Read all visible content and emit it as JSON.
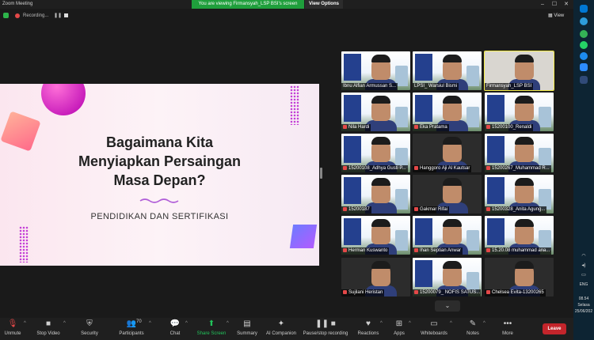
{
  "window": {
    "title": "Zoom Meeting",
    "viewing_banner": "You are viewing Firmansyah_LSP BSI's screen",
    "view_options": "View Options"
  },
  "status": {
    "recording_label": "Recording...",
    "view_label": "View"
  },
  "slide": {
    "title_line1": "Bagaimana Kita",
    "title_line2": "Menyiapkan Persaingan",
    "title_line3": "Masa Depan?",
    "subtitle": "PENDIDIKAN DAN SERTIFIKASI"
  },
  "participants": [
    {
      "name": "Ibnu Alfian Armussan S...",
      "muted": false,
      "style": "slide"
    },
    {
      "name": "LPSI_ Warsiul Bismi",
      "muted": false,
      "style": "slide"
    },
    {
      "name": "Firmansyah_LSP BSI",
      "muted": false,
      "style": "bright",
      "active": true
    },
    {
      "name": "Nila Hardi",
      "muted": true,
      "style": "slide"
    },
    {
      "name": "Eka Pratama",
      "muted": true,
      "style": "slide"
    },
    {
      "name": "15200100_Renaldi",
      "muted": true,
      "style": "slide"
    },
    {
      "name": "15200108_Adhya Gusti P...",
      "muted": true,
      "style": "slide"
    },
    {
      "name": "Hanggoro Aji Al Kautsar",
      "muted": true,
      "style": "dark"
    },
    {
      "name": "15200267_Muhammad R...",
      "muted": true,
      "style": "slide"
    },
    {
      "name": "15200187",
      "muted": true,
      "style": "slide"
    },
    {
      "name": "Gakmar Rifai",
      "muted": true,
      "style": "dark"
    },
    {
      "name": "15200328_Anita Agung...",
      "muted": true,
      "style": "slide"
    },
    {
      "name": "Herman Kuswanto",
      "muted": true,
      "style": "slide"
    },
    {
      "name": "Ihan Septian Anwar",
      "muted": true,
      "style": "slide"
    },
    {
      "name": "15.20.08 muhammad ana...",
      "muted": true,
      "style": "slide"
    },
    {
      "name": "Sujilani Heristan",
      "muted": true,
      "style": "dark"
    },
    {
      "name": "15200079_ NOFIS SATUS...",
      "muted": true,
      "style": "slide"
    },
    {
      "name": "Chelsea Evita-13200265",
      "muted": true,
      "style": "dark"
    }
  ],
  "toolbar": {
    "unmute": "Unmute",
    "stop_video": "Stop Video",
    "security": "Security",
    "participants": "Participants",
    "participants_count": "70",
    "chat": "Chat",
    "share_screen": "Share Screen",
    "summary": "Summary",
    "ai_companion": "AI Companion",
    "recording": "Pause/stop recording",
    "reactions": "Reactions",
    "apps": "Apps",
    "whiteboards": "Whiteboards",
    "notes": "Notes",
    "more": "More",
    "leave": "Leave"
  },
  "taskbar": {
    "language": "ENG",
    "time": "08.54",
    "day": "Selasa",
    "date": "25/06/202"
  }
}
